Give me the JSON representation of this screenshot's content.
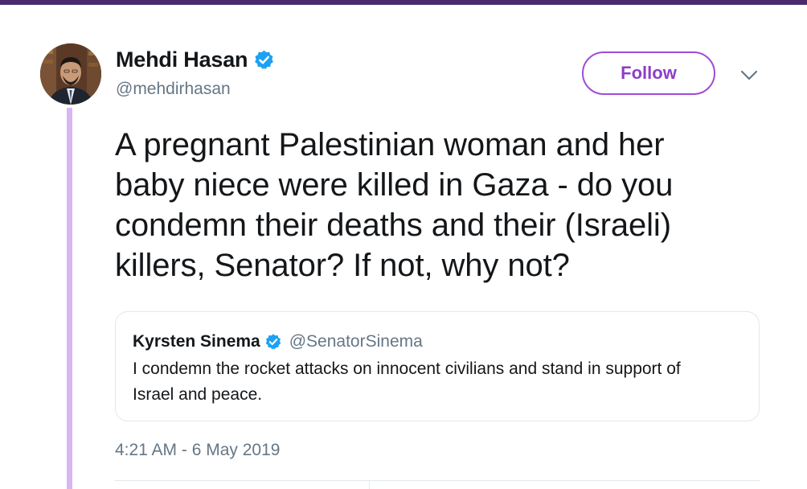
{
  "author": {
    "name": "Mehdi Hasan",
    "handle": "@mehdirhasan",
    "verified": true
  },
  "follow_button": {
    "label": "Follow"
  },
  "tweet": {
    "text_lines": [
      "A pregnant Palestinian woman and her",
      "baby niece were killed in Gaza - do you",
      "condemn their deaths and their (Israeli)",
      "killers, Senator? If not, why not?"
    ]
  },
  "quoted_tweet": {
    "name": "Kyrsten Sinema",
    "handle": "@SenatorSinema",
    "verified": true,
    "text_lines": [
      "I condemn the rocket attacks on innocent civilians and stand in support of",
      "Israel and peace."
    ]
  },
  "timestamp": "4:21 AM - 6 May 2019",
  "colors": {
    "accent": "#8e3ec6",
    "verified": "#1da1f2",
    "thread_line": "#d8b6f4",
    "top_bar": "#4a2a6b",
    "muted_text": "#657786"
  },
  "icons": {
    "verified": "verified-badge-icon",
    "menu": "chevron-down-icon"
  }
}
